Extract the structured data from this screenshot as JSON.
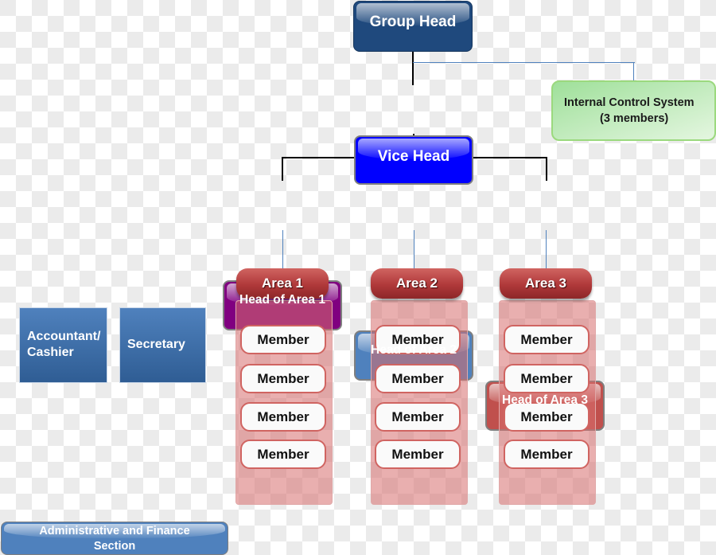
{
  "chart_title": "",
  "colors": {
    "group_head": "#1f497d",
    "vice_head": "#0000ff",
    "internal_control": "#9fe09a",
    "head_area_1": "#800080",
    "head_area_2": "#4f81bd",
    "head_area_3": "#c0504d",
    "area_pill": "#b0393a",
    "admin_section": "#4f81bd"
  },
  "nodes": {
    "group_head": "Group Head",
    "vice_head": "Vice Head",
    "internal_control": {
      "line1": "Internal Control System",
      "line2": "(3 members)"
    },
    "heads": [
      "Head of Area 1",
      "Head of Area 2",
      "Head of Area 3"
    ],
    "areas": [
      {
        "label": "Area 1",
        "members": [
          "Member",
          "Member",
          "Member",
          "Member"
        ]
      },
      {
        "label": "Area 2",
        "members": [
          "Member",
          "Member",
          "Member",
          "Member"
        ]
      },
      {
        "label": "Area 3",
        "members": [
          "Member",
          "Member",
          "Member",
          "Member"
        ]
      }
    ],
    "admin_section": {
      "line1": "Administrative and Finance",
      "line2": "Section",
      "roles": [
        {
          "line1": "Accountant/",
          "line2": "Cashier"
        },
        {
          "line1": "Secretary",
          "line2": ""
        }
      ]
    }
  }
}
